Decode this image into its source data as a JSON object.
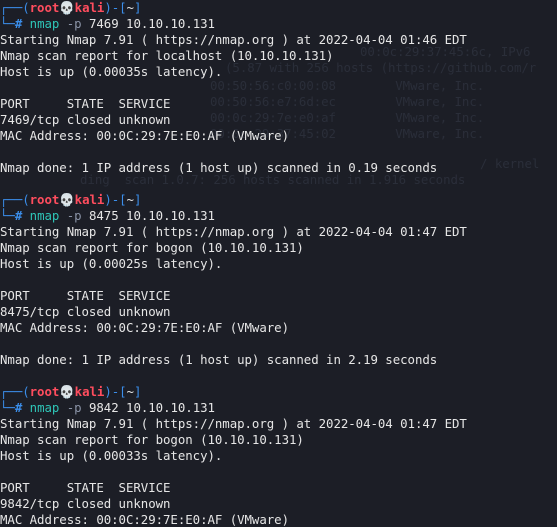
{
  "prompt": {
    "open": "┌──(",
    "user": "root",
    "skull": "💀",
    "host": "kali",
    "mid": ")-[",
    "dir": "~",
    "close": "]",
    "corner": "└─",
    "hash": "#"
  },
  "blocks": [
    {
      "command": "nmap",
      "flag": "-p",
      "args": "7469 10.10.10.131",
      "output": [
        "Starting Nmap 7.91 ( https://nmap.org ) at 2022-04-04 01:46 EDT",
        "Nmap scan report for localhost (10.10.10.131)",
        "Host is up (0.00035s latency).",
        "",
        "PORT     STATE  SERVICE",
        "7469/tcp closed unknown",
        "MAC Address: 00:0C:29:7E:E0:AF (VMware)",
        "",
        "Nmap done: 1 IP address (1 host up) scanned in 0.19 seconds",
        ""
      ]
    },
    {
      "command": "nmap",
      "flag": "-p",
      "args": "8475 10.10.10.131",
      "output": [
        "Starting Nmap 7.91 ( https://nmap.org ) at 2022-04-04 01:47 EDT",
        "Nmap scan report for bogon (10.10.10.131)",
        "Host is up (0.00025s latency).",
        "",
        "PORT     STATE  SERVICE",
        "8475/tcp closed unknown",
        "MAC Address: 00:0C:29:7E:E0:AF (VMware)",
        "",
        "Nmap done: 1 IP address (1 host up) scanned in 2.19 seconds",
        ""
      ]
    },
    {
      "command": "nmap",
      "flag": "-p",
      "args": "9842 10.10.10.131",
      "output": [
        "Starting Nmap 7.91 ( https://nmap.org ) at 2022-04-04 01:47 EDT",
        "Nmap scan report for bogon (10.10.10.131)",
        "Host is up (0.00033s latency).",
        "",
        "PORT     STATE  SERVICE",
        "9842/tcp closed unknown",
        "MAC Address: 00:0C:29:7E:E0:AF (VMware)"
      ]
    }
  ],
  "ghost_lines": [
    "00:0c:29:37:45:6c, IPv6",
    "(5.87 with 256 hosts (https://github.com/r",
    "00:50:56:c0:00:08        VMware, Inc.",
    "00:50:56:e7:6d:ec        VMware, Inc.",
    "00:0c:29:7e:e0:af        VMware, Inc.",
    "00:0c:29:37:45:02        VMware, Inc.",
    "ding  scan 1.0.7: 256 hosts scanned in 1.916 seconds",
    "/ kernel"
  ]
}
